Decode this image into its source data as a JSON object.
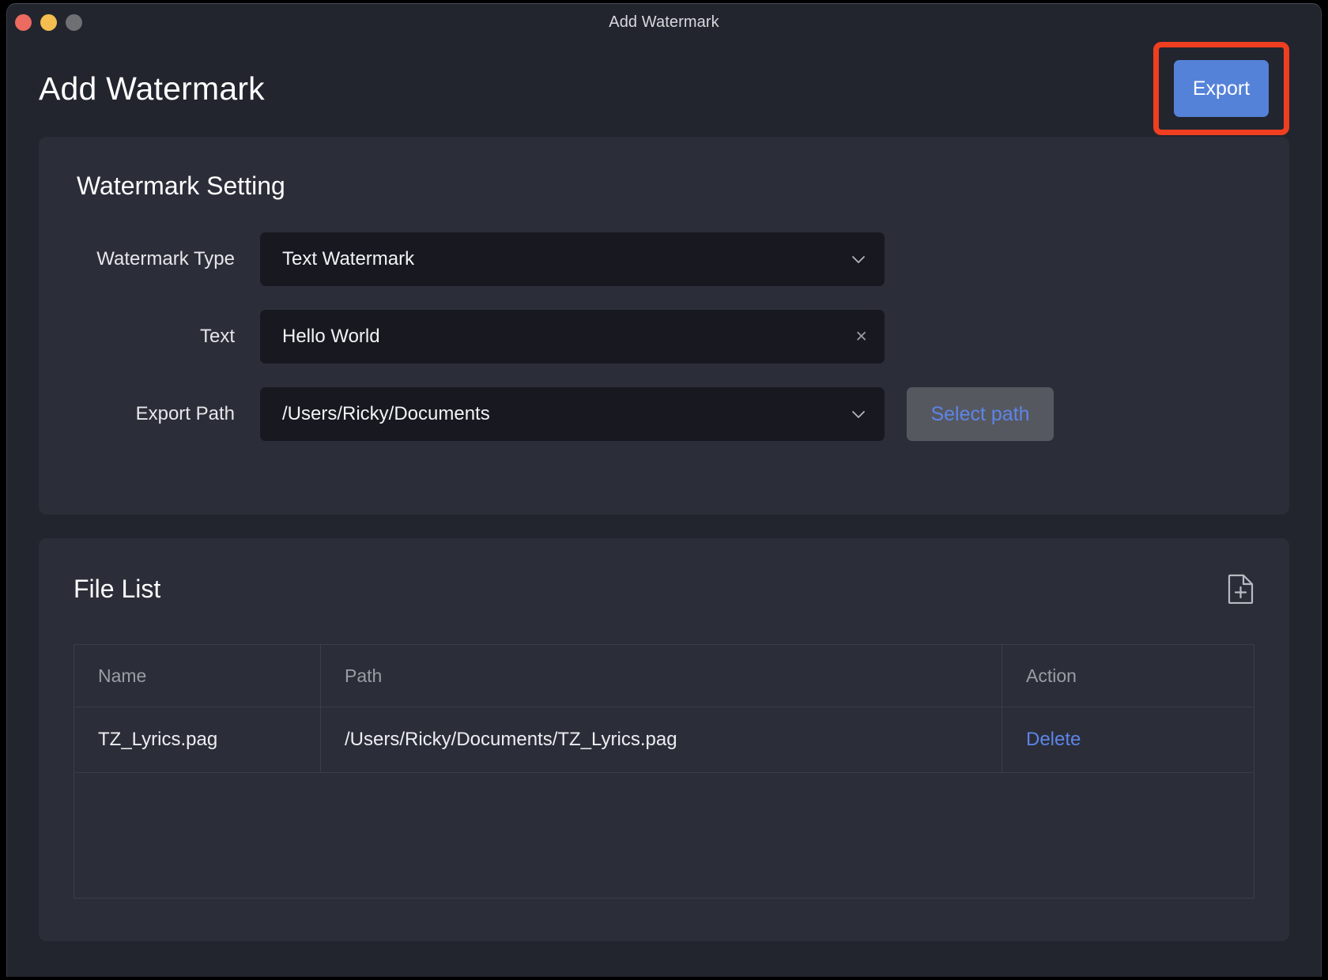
{
  "window": {
    "titlebar_title": "Add Watermark",
    "traffic_lights": [
      {
        "name": "close",
        "color": "#ec6a5f"
      },
      {
        "name": "minimize",
        "color": "#f4bd4f"
      },
      {
        "name": "zoom",
        "color": "#6e7074"
      }
    ]
  },
  "header": {
    "page_title": "Add Watermark",
    "export_label": "Export",
    "export_color": "#5582d9",
    "highlight_color": "#f03e20"
  },
  "watermark_setting": {
    "title": "Watermark Setting",
    "rows": {
      "type": {
        "label": "Watermark Type",
        "value": "Text Watermark",
        "icon": "chevron-down-icon"
      },
      "text": {
        "label": "Text",
        "value": "Hello World",
        "placeholder": "Hello World",
        "icon": "close-icon",
        "clear_glyph": "×"
      },
      "export_path": {
        "label": "Export Path",
        "value": "/Users/Ricky/Documents",
        "icon": "chevron-down-icon",
        "button_label": "Select path",
        "button_text_color": "#5d85e8"
      }
    }
  },
  "file_list": {
    "title": "File List",
    "add_icon": "add-file-icon",
    "columns": [
      "Name",
      "Path",
      "Action"
    ],
    "rows": [
      {
        "name": "TZ_Lyrics.pag",
        "path": "/Users/Ricky/Documents/TZ_Lyrics.pag",
        "action": "Delete"
      }
    ]
  }
}
